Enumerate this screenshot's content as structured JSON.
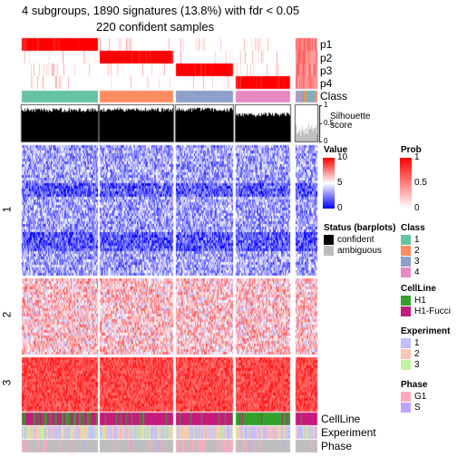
{
  "chart_data": {
    "type": "heatmap",
    "title": "4 subgroups, 1890 signatures (13.8%) with fdr < 0.05",
    "subtitle": "220 confident samples",
    "column_groups": [
      "1",
      "2",
      "3",
      "4",
      "ambiguous"
    ],
    "row_groups": [
      "1",
      "2",
      "3"
    ],
    "top_annotations": [
      "p1",
      "p2",
      "p3",
      "p4",
      "Class"
    ],
    "silhouette": {
      "label": "Silhouette\nscore",
      "ticks": [
        "0",
        "0.5",
        "1"
      ],
      "ylim": [
        0,
        1
      ]
    },
    "bottom_annotations": [
      "CellLine",
      "Experiment",
      "Phase"
    ],
    "legends": {
      "value": {
        "title": "Value",
        "ticks": [
          "0",
          "5",
          "10"
        ],
        "colors": [
          "#0000FF",
          "#FFFFFF",
          "#FF0000"
        ]
      },
      "prob": {
        "title": "Prob",
        "ticks": [
          "0",
          "0.5",
          "1"
        ],
        "colors": [
          "#FFFFFF",
          "#FF0000"
        ]
      },
      "status": {
        "title": "Status (barplots)",
        "items": [
          {
            "label": "confident",
            "color": "#000000"
          },
          {
            "label": "ambiguous",
            "color": "#BEBEBE"
          }
        ]
      },
      "class": {
        "title": "Class",
        "items": [
          {
            "label": "1",
            "color": "#66C2A5"
          },
          {
            "label": "2",
            "color": "#FC8D62"
          },
          {
            "label": "3",
            "color": "#8DA0CB"
          },
          {
            "label": "4",
            "color": "#E78AC3"
          }
        ]
      },
      "cellline": {
        "title": "CellLine",
        "items": [
          {
            "label": "H1",
            "color": "#33A02C"
          },
          {
            "label": "H1-Fucci",
            "color": "#C51B7D"
          }
        ]
      },
      "experiment": {
        "title": "Experiment",
        "items": [
          {
            "label": "1",
            "color": "#BFBFFF"
          },
          {
            "label": "2",
            "color": "#FFC4B5"
          },
          {
            "label": "3",
            "color": "#C3F2A0"
          }
        ]
      },
      "phase": {
        "title": "Phase",
        "items": [
          {
            "label": "G1",
            "color": "#FFA9C0"
          },
          {
            "label": "S",
            "color": "#C3A2FF"
          }
        ]
      }
    }
  }
}
